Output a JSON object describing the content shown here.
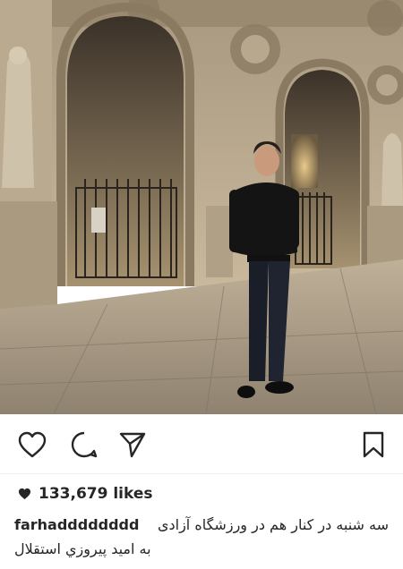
{
  "post": {
    "likes_count": "133,679 likes",
    "username": "farhadddddddd",
    "caption_line1": "سه شنبه در کنار هم در ورزشگاه آزادی",
    "caption_line2": "به امید پیروزي استقلال"
  },
  "actions": {
    "like": "heart-icon",
    "comment": "comment-icon",
    "share": "share-icon",
    "save": "bookmark-icon"
  },
  "colors": {
    "text": "#262626",
    "divider": "#efefef",
    "stone": "#b5a68d",
    "night": "#2c2620"
  }
}
